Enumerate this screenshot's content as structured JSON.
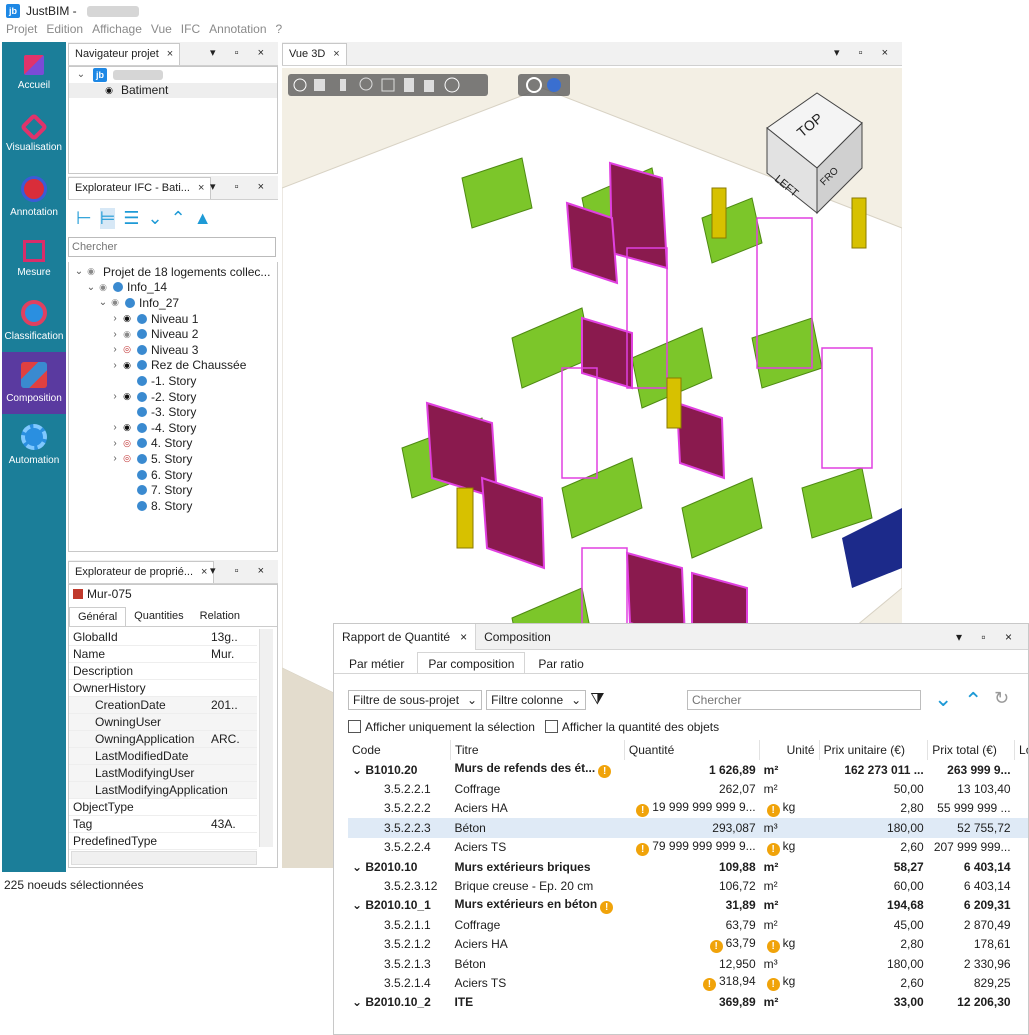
{
  "app": {
    "title": "JustBIM -",
    "logo": "jb"
  },
  "menu": [
    "Projet",
    "Edition",
    "Affichage",
    "Vue",
    "IFC",
    "Annotation",
    "?"
  ],
  "sidebar": [
    {
      "label": "Accueil",
      "color": "#e0336b"
    },
    {
      "label": "Visualisation",
      "color": "#e0336b"
    },
    {
      "label": "Annotation",
      "color": "#d92d3a"
    },
    {
      "label": "Mesure",
      "color": "#d92d6a"
    },
    {
      "label": "Classification",
      "color": "#2a8fe0"
    },
    {
      "label": "Composition",
      "color": "#e04040"
    },
    {
      "label": "Automation",
      "color": "#2a8fe0"
    }
  ],
  "nav_panel": {
    "tab": "Navigateur projet",
    "close": "×",
    "controls": "▾ ▫ ×",
    "root_logo": "jb",
    "child": "Batiment"
  },
  "ifc_panel": {
    "tab": "Explorateur IFC - Bati...",
    "close": "×",
    "controls": "▾ ▫ ×",
    "search_placeholder": "Chercher",
    "tree": [
      {
        "depth": 0,
        "caret": "⌄",
        "eye": "dim",
        "icon": false,
        "label": "Projet de 18 logements collec..."
      },
      {
        "depth": 1,
        "caret": "⌄",
        "eye": "dim",
        "icon": true,
        "label": "Info_14"
      },
      {
        "depth": 2,
        "caret": "⌄",
        "eye": "dim",
        "icon": true,
        "label": "Info_27"
      },
      {
        "depth": 3,
        "caret": "›",
        "eye": "on",
        "icon": true,
        "label": "Niveau 1"
      },
      {
        "depth": 3,
        "caret": "›",
        "eye": "dim",
        "icon": true,
        "label": "Niveau 2"
      },
      {
        "depth": 3,
        "caret": "›",
        "eye": "off",
        "icon": true,
        "label": "Niveau 3"
      },
      {
        "depth": 3,
        "caret": "›",
        "eye": "on",
        "icon": true,
        "label": "Rez de Chaussée"
      },
      {
        "depth": 3,
        "caret": "",
        "eye": "",
        "icon": true,
        "label": "-1. Story"
      },
      {
        "depth": 3,
        "caret": "›",
        "eye": "on",
        "icon": true,
        "label": "-2. Story"
      },
      {
        "depth": 3,
        "caret": "",
        "eye": "",
        "icon": true,
        "label": "-3. Story"
      },
      {
        "depth": 3,
        "caret": "›",
        "eye": "on",
        "icon": true,
        "label": "-4. Story"
      },
      {
        "depth": 3,
        "caret": "›",
        "eye": "off",
        "icon": true,
        "label": "4. Story"
      },
      {
        "depth": 3,
        "caret": "›",
        "eye": "off",
        "icon": true,
        "label": "5. Story"
      },
      {
        "depth": 3,
        "caret": "",
        "eye": "",
        "icon": true,
        "label": "6. Story"
      },
      {
        "depth": 3,
        "caret": "",
        "eye": "",
        "icon": true,
        "label": "7. Story"
      },
      {
        "depth": 3,
        "caret": "",
        "eye": "",
        "icon": true,
        "label": "8. Story"
      }
    ]
  },
  "prop_panel": {
    "tab": "Explorateur de proprié...",
    "close": "×",
    "controls": "▾ ▫ ×",
    "object": "Mur-075",
    "tabs": [
      "Général",
      "Quantities",
      "Relation"
    ],
    "rows": [
      {
        "k": "GlobalId",
        "v": "13g..",
        "indent": false
      },
      {
        "k": "Name",
        "v": "Mur.",
        "indent": false
      },
      {
        "k": "Description",
        "v": "",
        "indent": false
      },
      {
        "k": "OwnerHistory",
        "v": "",
        "indent": false
      },
      {
        "k": "CreationDate",
        "v": "201..",
        "indent": true
      },
      {
        "k": "OwningUser",
        "v": "",
        "indent": true
      },
      {
        "k": "OwningApplication",
        "v": "ARC.",
        "indent": true
      },
      {
        "k": "LastModifiedDate",
        "v": "",
        "indent": true
      },
      {
        "k": "LastModifyingUser",
        "v": "",
        "indent": true
      },
      {
        "k": "LastModifyingApplication",
        "v": "",
        "indent": true
      },
      {
        "k": "ObjectType",
        "v": "",
        "indent": false
      },
      {
        "k": "Tag",
        "v": "43A.",
        "indent": false
      },
      {
        "k": "PredefinedType",
        "v": "",
        "indent": false
      }
    ]
  },
  "view3d": {
    "tab": "Vue 3D",
    "close": "×",
    "controls": "▾ ▫ ×",
    "cube_top": "TOP",
    "cube_left": "LEFT",
    "cube_front": "FRO"
  },
  "status": "225 noeuds sélectionnées",
  "report": {
    "tab1": "Rapport de Quantité",
    "close": "×",
    "tab2": "Composition",
    "controls": "▾ ▫ ×",
    "subtabs": [
      "Par métier",
      "Par composition",
      "Par ratio"
    ],
    "filter1": "Filtre de sous-projet",
    "filter2": "Filtre colonne",
    "search_placeholder": "Chercher",
    "check1": "Afficher uniquement la sélection",
    "check2": "Afficher la quantité des objets",
    "headers": [
      "Code",
      "Titre",
      "Quantité",
      "Unité",
      "Prix unitaire (€)",
      "Prix total (€)",
      "Lo"
    ],
    "rows": [
      {
        "group": true,
        "code": "B1010.20",
        "title": "Murs de refends des ét...",
        "tw": true,
        "qw": false,
        "qty": "1 626,89",
        "unit": "m²",
        "uw": false,
        "pu": "162 273 011 ...",
        "pt": "263 999 9...",
        "sel": false
      },
      {
        "group": false,
        "code": "3.5.2.2.1",
        "title": "Coffrage",
        "tw": false,
        "qw": false,
        "qty": "262,07",
        "unit": "m²",
        "uw": false,
        "pu": "50,00",
        "pt": "13 103,40",
        "sel": false
      },
      {
        "group": false,
        "code": "3.5.2.2.2",
        "title": "Aciers HA",
        "tw": false,
        "qw": true,
        "qty": "19 999 999 999 9...",
        "unit": "kg",
        "uw": true,
        "pu": "2,80",
        "pt": "55 999 999 ...",
        "sel": false
      },
      {
        "group": false,
        "code": "3.5.2.2.3",
        "title": "Béton",
        "tw": false,
        "qw": false,
        "qty": "293,087",
        "unit": "m³",
        "uw": false,
        "pu": "180,00",
        "pt": "52 755,72",
        "sel": true
      },
      {
        "group": false,
        "code": "3.5.2.2.4",
        "title": "Aciers TS",
        "tw": false,
        "qw": true,
        "qty": "79 999 999 999 9...",
        "unit": "kg",
        "uw": true,
        "pu": "2,60",
        "pt": "207 999 999...",
        "sel": false
      },
      {
        "group": true,
        "code": "B2010.10",
        "title": "Murs extérieurs briques",
        "tw": false,
        "qw": false,
        "qty": "109,88",
        "unit": "m²",
        "uw": false,
        "pu": "58,27",
        "pt": "6 403,14",
        "sel": false
      },
      {
        "group": false,
        "code": "3.5.2.3.12",
        "title": "Brique creuse - Ep. 20 cm",
        "tw": false,
        "qw": false,
        "qty": "106,72",
        "unit": "m²",
        "uw": false,
        "pu": "60,00",
        "pt": "6 403,14",
        "sel": false
      },
      {
        "group": true,
        "code": "B2010.10_1",
        "title": "Murs extérieurs en béton",
        "tw": true,
        "qw": false,
        "qty": "31,89",
        "unit": "m²",
        "uw": false,
        "pu": "194,68",
        "pt": "6 209,31",
        "sel": false
      },
      {
        "group": false,
        "code": "3.5.2.1.1",
        "title": "Coffrage",
        "tw": false,
        "qw": false,
        "qty": "63,79",
        "unit": "m²",
        "uw": false,
        "pu": "45,00",
        "pt": "2 870,49",
        "sel": false
      },
      {
        "group": false,
        "code": "3.5.2.1.2",
        "title": "Aciers HA",
        "tw": false,
        "qw": true,
        "qty": "63,79",
        "unit": "kg",
        "uw": true,
        "pu": "2,80",
        "pt": "178,61",
        "sel": false
      },
      {
        "group": false,
        "code": "3.5.2.1.3",
        "title": "Béton",
        "tw": false,
        "qw": false,
        "qty": "12,950",
        "unit": "m³",
        "uw": false,
        "pu": "180,00",
        "pt": "2 330,96",
        "sel": false
      },
      {
        "group": false,
        "code": "3.5.2.1.4",
        "title": "Aciers TS",
        "tw": false,
        "qw": true,
        "qty": "318,94",
        "unit": "kg",
        "uw": true,
        "pu": "2,60",
        "pt": "829,25",
        "sel": false
      },
      {
        "group": true,
        "code": "B2010.10_2",
        "title": "ITE",
        "tw": false,
        "qw": false,
        "qty": "369,89",
        "unit": "m²",
        "uw": false,
        "pu": "33,00",
        "pt": "12 206,30",
        "sel": false
      }
    ]
  }
}
